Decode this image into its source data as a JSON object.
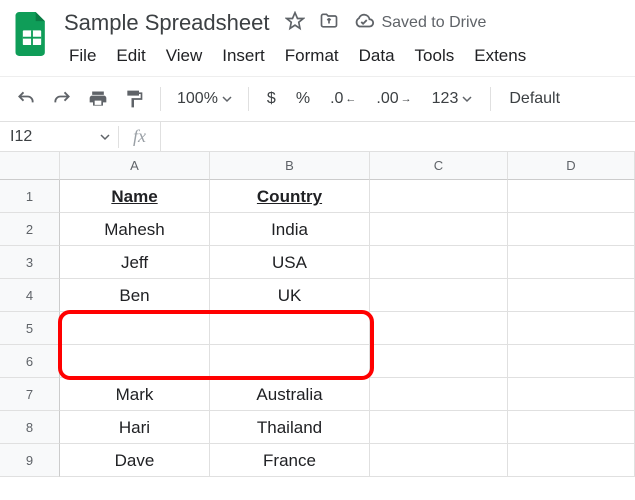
{
  "doc": {
    "title": "Sample Spreadsheet",
    "save_status": "Saved to Drive"
  },
  "menu": {
    "file": "File",
    "edit": "Edit",
    "view": "View",
    "insert": "Insert",
    "format": "Format",
    "data": "Data",
    "tools": "Tools",
    "extensions": "Extens"
  },
  "toolbar": {
    "zoom": "100%",
    "currency": "$",
    "percent": "%",
    "dec_dec": ".0",
    "inc_dec": ".00",
    "num_fmt": "123",
    "font": "Default"
  },
  "formula": {
    "cell_ref": "I12",
    "fx": "fx"
  },
  "columns": [
    "A",
    "B",
    "C",
    "D"
  ],
  "rows": [
    "1",
    "2",
    "3",
    "4",
    "5",
    "6",
    "7",
    "8",
    "9"
  ],
  "cells": {
    "r0": {
      "a": "Name",
      "b": "Country"
    },
    "r1": {
      "a": "Mahesh",
      "b": "India"
    },
    "r2": {
      "a": "Jeff",
      "b": "USA"
    },
    "r3": {
      "a": "Ben",
      "b": "UK"
    },
    "r4": {
      "a": "",
      "b": ""
    },
    "r5": {
      "a": "",
      "b": ""
    },
    "r6": {
      "a": "Mark",
      "b": "Australia"
    },
    "r7": {
      "a": "Hari",
      "b": "Thailand"
    },
    "r8": {
      "a": "Dave",
      "b": "France"
    }
  }
}
